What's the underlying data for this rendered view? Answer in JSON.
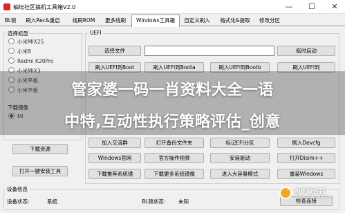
{
  "window": {
    "title": "柚坛社区搞机工具箱V2.0",
    "minimize": "—",
    "maximize": "☐",
    "close": "✕"
  },
  "tabs": [
    "BL锁",
    "刷入Rec&重启",
    "线刷ROM",
    "更多线刷",
    "Windows工具箱",
    "自定义刷入",
    "格式化&提取",
    "修改分区"
  ],
  "active_tab": "Windows工具箱",
  "left_panel": {
    "model_group_title": "选择机型",
    "models": [
      "小米MIX2S",
      "小米8",
      "Redmi K20Pro",
      "小米MIX3",
      "小米平板",
      "小米平板"
    ],
    "download_group_title": "下载镜像",
    "download_option": "Mi",
    "buttons": {
      "download_resources": "下载资源",
      "open_install_tool": "打开一键安装工具"
    }
  },
  "uefi": {
    "group_title": "UEFI",
    "select_file": "选择文件",
    "file_path": "",
    "temp_boot": "临时启动",
    "row2": [
      "刷入UEFI到Boot",
      "刷入UEFI到Boota",
      "刷入UEFI到Bootb",
      "刷入UEFI到"
    ],
    "row6": [
      "加入交流群",
      "打开备份文件夹",
      "标记EFI分区",
      "刷入Devcfg"
    ],
    "row7": [
      "Windows官网",
      "官方操作视频",
      "安装驱动",
      "打开Disim++"
    ],
    "row8": [
      "下载推荐系统镜",
      "下载更多系统镜像",
      "进入大容量模式",
      "重装Windows"
    ]
  },
  "watermark": {
    "line1": "管家婆一码一肖资料大全一语",
    "line2": "中特,互动性执行策略评估_创意",
    "logo_text": "当下软件园",
    "logo_sub": "www.downxia.com"
  },
  "status": {
    "group_title": "设备信息",
    "device_state_label": "设备状态:",
    "device_state_value": "系统",
    "bl_lock_label": "BL锁状态:",
    "bl_lock_value": "未知",
    "refresh_button": "检查连接"
  },
  "colors": {
    "titlebar": "#ffffff",
    "button": "#e1e1e1",
    "window_bg": "#f0f0f0",
    "title_icon": "#d8262a"
  }
}
